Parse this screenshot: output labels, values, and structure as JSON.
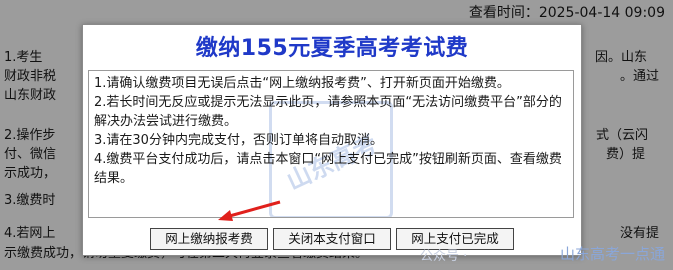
{
  "background": {
    "query_time_label": "查看时间：",
    "query_time_value": "2025-04-14 09:09",
    "fragments": {
      "item1_left": "1.考生",
      "item1_right": "因。山东",
      "line2_left": "财政非税",
      "line2_right": "。通过",
      "line3_left": "山东财政",
      "item2_left": "2.操作步",
      "item2_right": "式（云闪",
      "line5_left": "付、微信",
      "line5_right": "费）提",
      "line6_left": "示成功，",
      "item3_left": "3.缴费时",
      "item4_left": "4.若网上",
      "item4_right": "没有提",
      "line9_text": "示缴费成功，请勿重复缴费，可在第二天再登录查看缴费结果。"
    }
  },
  "dialog": {
    "title": "缴纳155元夏季高考考试费",
    "notices": [
      "1.请确认缴费项目无误后点击“网上缴纳报考费”、打开新页面开始缴费。",
      "2.若长时间无反应或提示无法显示此页，请参照本页面“无法访问缴费平台”部分的解决办法尝试进行缴费。",
      "3.请在30分钟内完成支付，否则订单将自动取消。",
      "4.缴费平台支付成功后，请点击本窗口“网上支付已完成”按钮刷新页面、查看缴费结果。"
    ],
    "buttons": {
      "pay": "网上缴纳报考费",
      "close": "关闭本支付窗口",
      "done": "网上支付已完成"
    }
  },
  "watermarks": {
    "center_text": "山东高考",
    "gzh": "公众号 ·",
    "brand": "山东高考一点通"
  },
  "colors": {
    "title": "#1f39c8",
    "arrow": "#e0201c",
    "overlay": "#9c9c9c"
  }
}
